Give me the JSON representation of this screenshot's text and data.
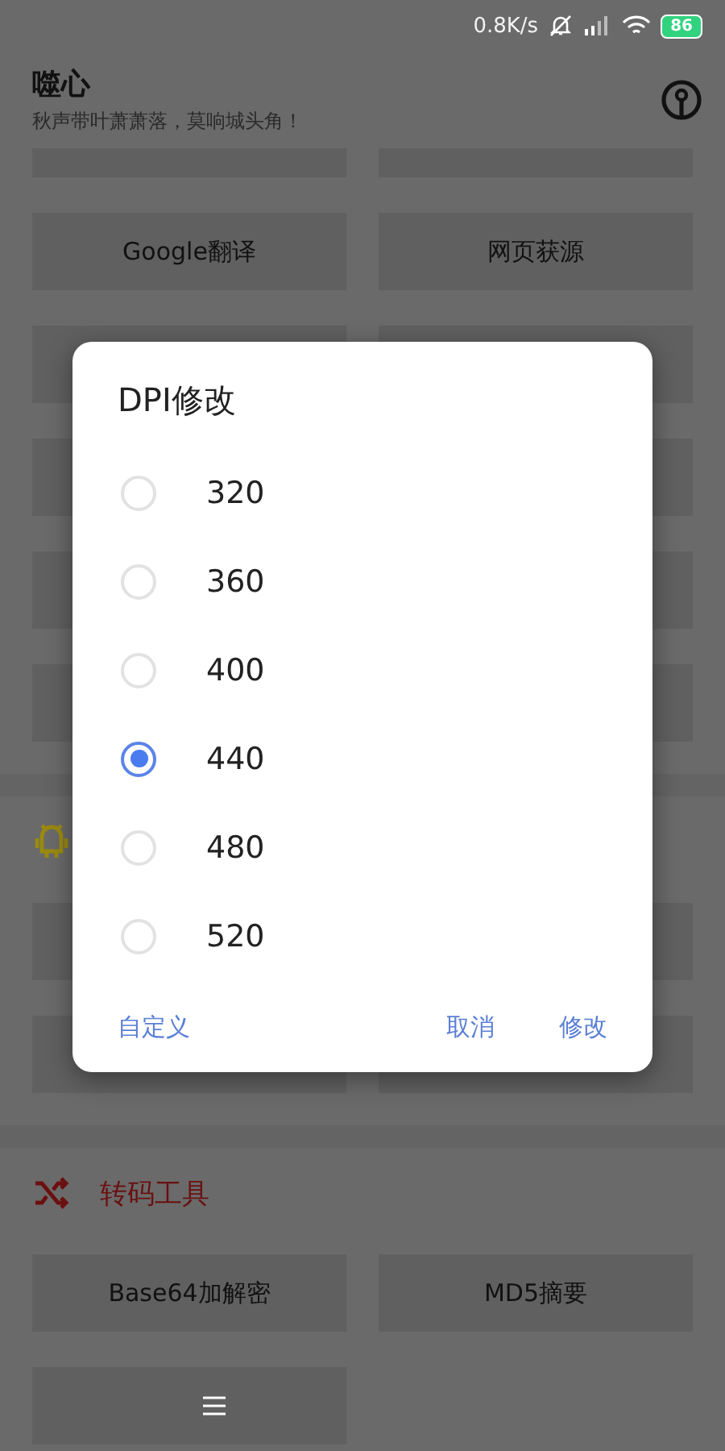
{
  "status_bar": {
    "net_speed": "0.8K/s",
    "battery": "86"
  },
  "header": {
    "title": "噬心",
    "subtitle": "秋声带叶萧萧落，莫响城头角！"
  },
  "sections": [
    {
      "kind": "none",
      "cards": [
        {
          "kind": "hidden"
        },
        {
          "kind": "hidden"
        },
        {
          "kind": "tool",
          "label": "Google翻译"
        },
        {
          "kind": "tool",
          "label": "网页获源"
        },
        {
          "kind": "hidden"
        },
        {
          "kind": "hidden"
        },
        {
          "kind": "hidden"
        },
        {
          "kind": "hidden"
        },
        {
          "kind": "hidden"
        },
        {
          "kind": "hidden"
        },
        {
          "kind": "hidden"
        },
        {
          "kind": "hidden"
        }
      ]
    },
    {
      "kind": "android",
      "color": "#9a8a10",
      "cards": [
        {
          "kind": "hidden"
        },
        {
          "kind": "hidden"
        },
        {
          "kind": "hidden"
        },
        {
          "kind": "hidden"
        }
      ]
    },
    {
      "kind": "shuffle",
      "color": "#6a1010",
      "title": "转码工具",
      "cards": [
        {
          "kind": "tool",
          "label": "Base64加解密"
        },
        {
          "kind": "tool",
          "label": "MD5摘要"
        },
        {
          "kind": "hidden"
        }
      ]
    }
  ],
  "dialog": {
    "title": "DPI修改",
    "options": [
      {
        "label": "320",
        "selected": false
      },
      {
        "label": "360",
        "selected": false
      },
      {
        "label": "400",
        "selected": false
      },
      {
        "label": "440",
        "selected": true
      },
      {
        "label": "480",
        "selected": false
      },
      {
        "label": "520",
        "selected": false
      }
    ],
    "left_button": "自定义",
    "buttons": [
      "取消",
      "修改"
    ]
  }
}
